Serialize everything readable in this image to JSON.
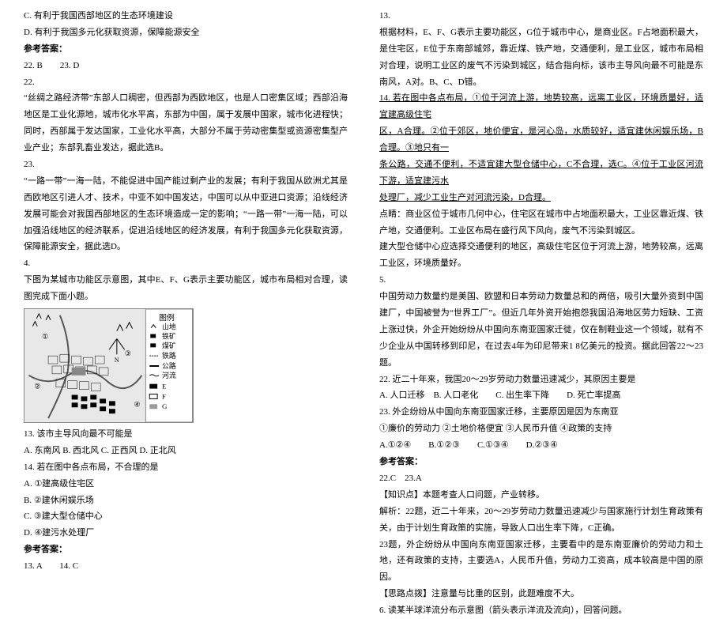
{
  "left": {
    "l1": "C. 有利于我国西部地区的生态环境建设",
    "l2": "D. 有利于我国多元化获取资源，保障能源安全",
    "ans1": "参考答案：",
    "ans1v": "22. B　　23. D",
    "l3": "22.",
    "l4": "“丝绸之路经济带”东部人口稠密，但西部为西欧地区，也是人口密集区域；西部沿海地区是工业化源地，城市化水平高，东部为中国，属于发展中国家，城市化进程快；同时，西部属于发达国家，工业化水平高，大部分不属于劳动密集型或资源密集型产业产业；东部乳畜业发达，据此选B。",
    "l5": "23.",
    "l6": "“一路一带”一海一陆，不能促进中国产能过剩产业的发展；有利于我国从欧洲尤其是西欧地区引进人才、技术，中亚不如中国发达，中国可以从中亚进口资源；沿线经济发展可能会对我国西部地区的生态环境造成一定的影响；“一路一带”一海一陆，可以加强沿线地区的经济联系，促进沿线地区的经济发展，有利于我国多元化获取资源，保障能源安全，据此选D。",
    "q4": "4.",
    "q4t": "下图为某城市功能区示意图，其中E、F、G表示主要功能区，城市布局相对合理，读图完成下面小题。",
    "fig_legend_title": "图例",
    "fig_legend_rows": [
      "山地",
      "铁矿",
      "煤矿",
      "铁路",
      "公路",
      "河流",
      "E",
      "F",
      "G"
    ],
    "q13": "13. 该市主导风向最不可能是",
    "q13a": "A. 东南风 B. 西北风 C. 正西风 D. 正北风",
    "q14": "14. 若在图中各点布局，不合理的是",
    "q14a": "A. ①建高级住宅区",
    "q14b": "B. ②建休闲娱乐场",
    "q14c": "C. ③建大型仓储中心",
    "q14d": "D. ④建污水处理厂",
    "ans2": "参考答案：",
    "ans2v": "13. A　　14. C"
  },
  "right": {
    "r1": "13.",
    "r2": "根据材料，E、F、G表示主要功能区，G位于城市中心，是商业区。F占地面积最大，是住宅区，E位于东南部城郊，靠近煤、铁产地，交通便利，是工业区，城市布局相对合理，说明工业区的废气不污染到城区，结合指向标，该市主导风向最不可能是东南风，A对。B、C、D错。",
    "r3": "14. 若在图中各点布局，①位于河流上游，地势较高，远离工业区，环境质量好，适宜建高级住宅",
    "r4": "区，A合理。②位于郊区，地价便宜，是河心岛，水质较好，适宜建休闲娱乐场，B合理。③地只有一",
    "r5": "条公路，交通不便利，不适宜建大型仓储中心，C不合理，选C。④位于工业区河流下游，适宜建污水",
    "r6": "处理厂，减少工业生产对河流污染，D合理。",
    "r7": "点睛：商业区位于城市几何中心，住宅区在城市中占地面积最大，工业区靠近煤、铁产地，交通便利。工业区布局在盛行风下风向，废气不污染到城区。",
    "r8": "建大型仓储中心应选择交通便利的地区，高级住宅区位于河流上游，地势较高，远离工业区，环境质量好。",
    "q5": "5.",
    "q5t": "中国劳动力数量约是美国、欧盟和日本劳动力数量总和的两倍，吸引大量外资到中国建厂，中国被誉为“世界工厂”。但近几年外资开始抱怨我国沿海地区劳力短缺、工资上涨过快，外企开始纷纷从中国向东南亚国家迁徙，仅在制鞋业这一个领域，就有不少企业从中国转移到印尼，在过去4年为印尼带来1 8亿美元的投资。据此回答22～23题。",
    "q22": "22. 近二十年来，我国20～29岁劳动力数量迅速减少，其原因主要是",
    "q22a": "A. 人口迁移　B. 人口老化　　C. 出生率下降　　D. 死亡率提高",
    "q23": "23. 外企纷纷从中国向东南亚国家迁移，主要原因是因为东南亚",
    "q23o": "①廉价的劳动力 ②土地价格便宜 ③人民币升值 ④政策的支持",
    "q23a": "A.①②④　　B.①②③　　C.①③④　　D.②③④",
    "ans3": "参考答案：",
    "ans3v": "22.C　23.A",
    "kn": "【知识点】本题考查人口问题，产业转移。",
    "ex22": "解析：22题，近二十年来，20～29岁劳动力数量迅速减少与国家施行计划生育政策有关，由于计划生育政策的实施，导致人口出生率下降，C正确。",
    "ex23": "23题，外企纷纷从中国向东南亚国家迁移，主要看中的是东南亚廉价的劳动力和土地，还有政策的支持，主要选A，人民币升值，劳动力工资高，成本较高是中国的原因。",
    "tip": "【思路点拨】注意量与比重的区别，此题难度不大。",
    "q6": "6. 读某半球洋流分布示意图（箭头表示洋流及流向），回答问题。"
  }
}
